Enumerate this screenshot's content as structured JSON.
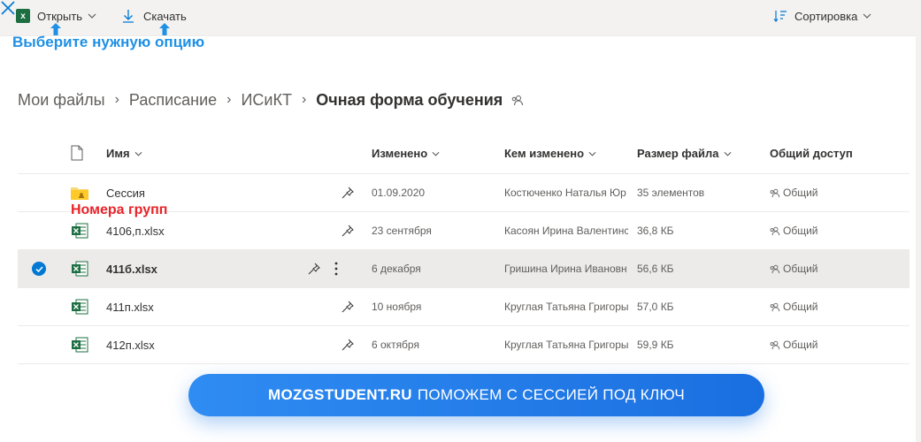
{
  "toolbar": {
    "open_label": "Открыть",
    "download_label": "Скачать",
    "sort_label": "Сортировка",
    "excel_badge": "x"
  },
  "annotations": {
    "hint": "Выберите нужную опцию",
    "group_note": "Номера групп"
  },
  "breadcrumb": {
    "items": [
      "Мои файлы",
      "Расписание",
      "ИСиКТ"
    ],
    "current": "Очная форма обучения"
  },
  "table": {
    "headers": {
      "name": "Имя",
      "modified": "Изменено",
      "modified_by": "Кем изменено",
      "size": "Размер файла",
      "sharing": "Общий доступ"
    },
    "rows": [
      {
        "name": "Сессия",
        "type": "folder",
        "modified": "01.09.2020",
        "modified_by": "Костюченко Наталья Юр",
        "size": "35 элементов",
        "sharing": "Общий",
        "selected": false
      },
      {
        "name": "4106,п.xlsx",
        "type": "excel",
        "modified": "23 сентября",
        "modified_by": "Касоян Ирина Валентинс",
        "size": "36,8 КБ",
        "sharing": "Общий",
        "selected": false
      },
      {
        "name": "411б.xlsx",
        "type": "excel",
        "modified": "6 декабря",
        "modified_by": "Гришина Ирина Ивановн",
        "size": "56,6 КБ",
        "sharing": "Общий",
        "selected": true
      },
      {
        "name": "411п.xlsx",
        "type": "excel",
        "modified": "10 ноября",
        "modified_by": "Круглая Татьяна Григоры",
        "size": "57,0 КБ",
        "sharing": "Общий",
        "selected": false
      },
      {
        "name": "412п.xlsx",
        "type": "excel",
        "modified": "6 октября",
        "modified_by": "Круглая Татьяна Григоры",
        "size": "59,9 КБ",
        "sharing": "Общий",
        "selected": false
      }
    ]
  },
  "banner": {
    "brand": "MOZGSTUDENT.RU",
    "text": "ПОМОЖЕМ С СЕССИЕЙ ПОД КЛЮЧ"
  },
  "colors": {
    "accent": "#0078d4",
    "excel": "#1d6f42",
    "hint": "#1e90e6",
    "note": "#e8242a",
    "banner": "#2f8cf2"
  }
}
